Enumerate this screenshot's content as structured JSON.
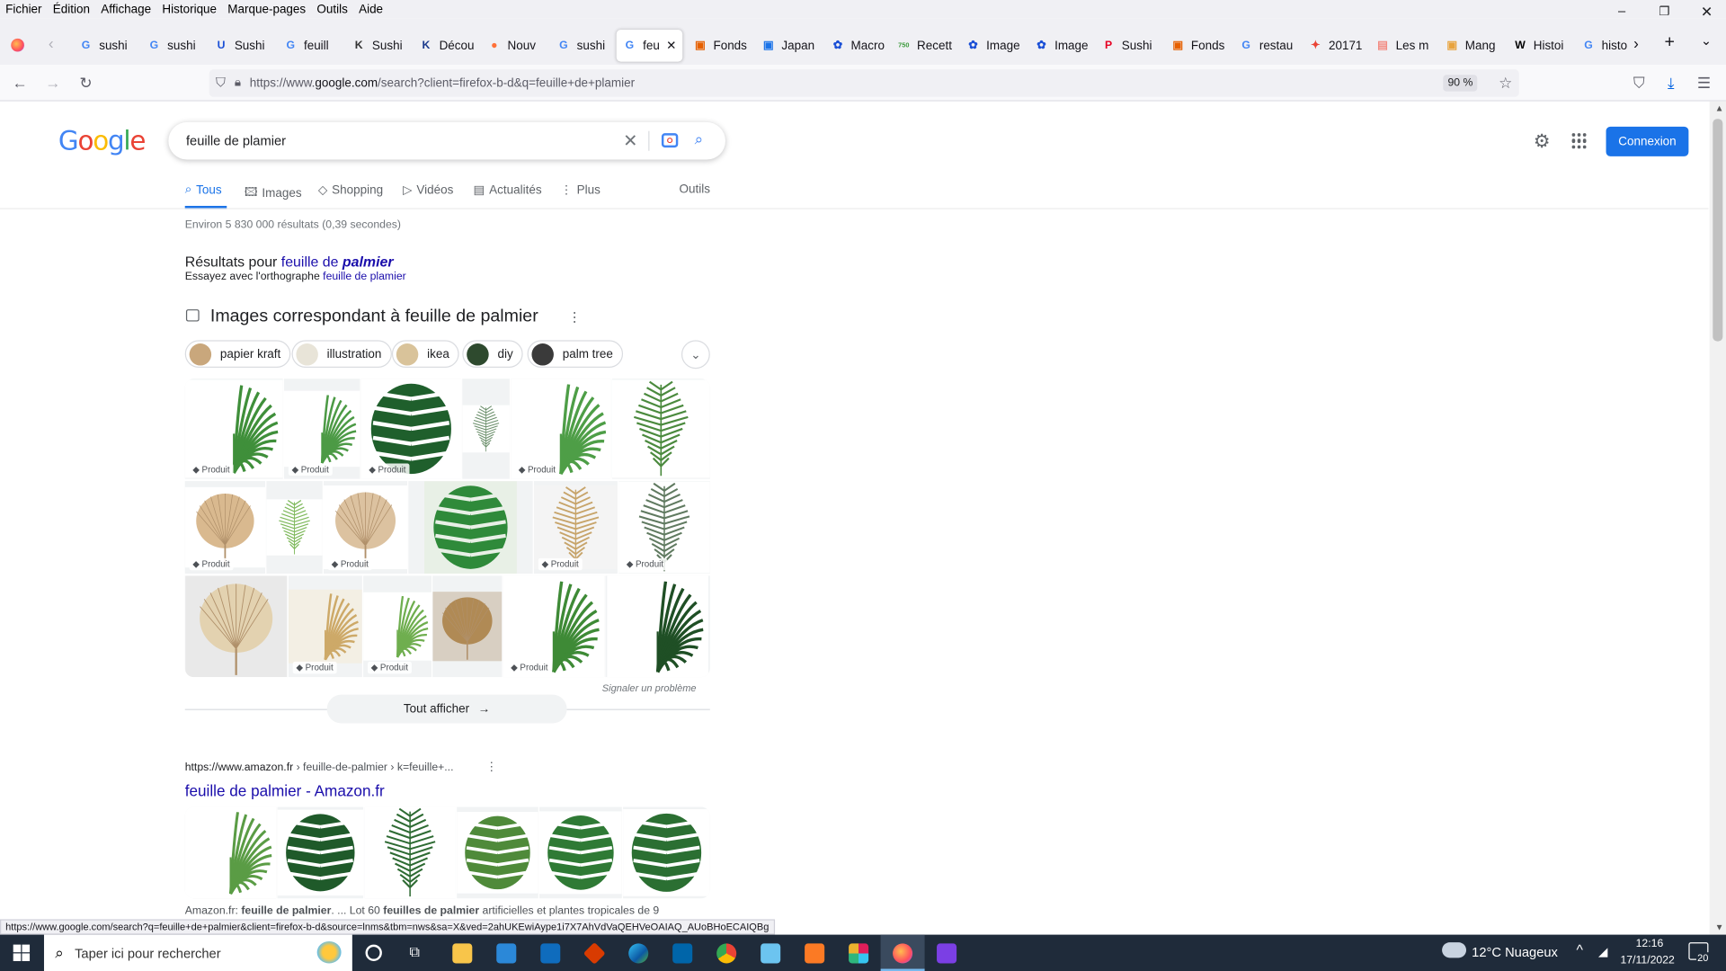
{
  "menu": [
    "Fichier",
    "Édition",
    "Affichage",
    "Historique",
    "Marque-pages",
    "Outils",
    "Aide"
  ],
  "tabs": [
    {
      "label": "sushi",
      "fav": "G",
      "color": "#4285f4"
    },
    {
      "label": "sushi",
      "fav": "G",
      "color": "#4285f4"
    },
    {
      "label": "Sushi",
      "fav": "U",
      "color": "#1a4fd6"
    },
    {
      "label": "feuill",
      "fav": "G",
      "color": "#4285f4"
    },
    {
      "label": "Sushi",
      "fav": "K",
      "color": "#333"
    },
    {
      "label": "Décou",
      "fav": "K",
      "color": "#1b3a8c"
    },
    {
      "label": "Nouv",
      "fav": "●",
      "color": "#ff7139"
    },
    {
      "label": "sushi",
      "fav": "G",
      "color": "#4285f4"
    },
    {
      "label": "feu",
      "fav": "G",
      "color": "#4285f4",
      "active": true
    },
    {
      "label": "Fonds",
      "fav": "▣",
      "color": "#e66000"
    },
    {
      "label": "Japan",
      "fav": "▣",
      "color": "#1a73e8"
    },
    {
      "label": "Macro",
      "fav": "✿",
      "color": "#1a4fd6"
    },
    {
      "label": "Recett",
      "fav": "750",
      "color": "#3c9a3c"
    },
    {
      "label": "Image",
      "fav": "✿",
      "color": "#1a4fd6"
    },
    {
      "label": "Image",
      "fav": "✿",
      "color": "#1a4fd6"
    },
    {
      "label": "Sushi",
      "fav": "P",
      "color": "#e60023"
    },
    {
      "label": "Fonds",
      "fav": "▣",
      "color": "#e66000"
    },
    {
      "label": "restau",
      "fav": "G",
      "color": "#4285f4"
    },
    {
      "label": "20171",
      "fav": "✦",
      "color": "#ea4335"
    },
    {
      "label": "Les m",
      "fav": "▤",
      "color": "#f28b82"
    },
    {
      "label": "Mang",
      "fav": "▣",
      "color": "#e8a33d"
    },
    {
      "label": "Histoi",
      "fav": "W",
      "color": "#000"
    },
    {
      "label": "histo",
      "fav": "G",
      "color": "#4285f4"
    }
  ],
  "url": {
    "prefix": "https://www.",
    "domain": "google.com",
    "rest": "/search?client=firefox-b-d&q=feuille+de+plamier",
    "zoom": "90 %"
  },
  "search": {
    "query": "feuille de plamier",
    "connexion": "Connexion"
  },
  "navtabs": [
    {
      "label": "Tous",
      "icon": "search-icon"
    },
    {
      "label": "Images",
      "icon": "image-icon"
    },
    {
      "label": "Shopping",
      "icon": "tag-icon"
    },
    {
      "label": "Vidéos",
      "icon": "video-icon"
    },
    {
      "label": "Actualités",
      "icon": "news-icon"
    },
    {
      "label": "Plus",
      "icon": "more-icon"
    }
  ],
  "outils": "Outils",
  "stats": "Environ 5 830 000 résultats (0,39 secondes)",
  "spell": {
    "prefix": "Résultats pour ",
    "plain": "feuille de ",
    "bold": "palmier",
    "try": "Essayez avec l'orthographe ",
    "orig": "feuille de plamier"
  },
  "images_title": "Images correspondant à feuille de palmier",
  "chips": [
    "papier kraft",
    "illustration",
    "ikea",
    "diy",
    "palm tree"
  ],
  "produit": "Produit",
  "report": "Signaler un problème",
  "show_all": "Tout afficher",
  "result": {
    "cite_domain": "https://www.amazon.fr",
    "cite_path": " › feuille-de-palmier › k=feuille+...",
    "title": "feuille de palmier - Amazon.fr",
    "snippet_a": "Amazon.fr: ",
    "snippet_b": "feuille de palmier",
    "snippet_c": ". ... Lot 60 ",
    "snippet_d": "feuilles de palmier",
    "snippet_e": " artificielles et plantes tropicales de 9"
  },
  "status_url": "https://www.google.com/search?q=feuille+de+palmier&client=firefox-b-d&source=lnms&tbm=nws&sa=X&ved=2ahUKEwiAype1i7X7AhVdVaQEHVeOAIAQ_AUoBHoECAIQBg",
  "taskbar": {
    "search": "Taper ici pour rechercher",
    "weather": "12°C  Nuageux",
    "time": "12:16",
    "date": "17/11/2022",
    "notif": "20"
  }
}
